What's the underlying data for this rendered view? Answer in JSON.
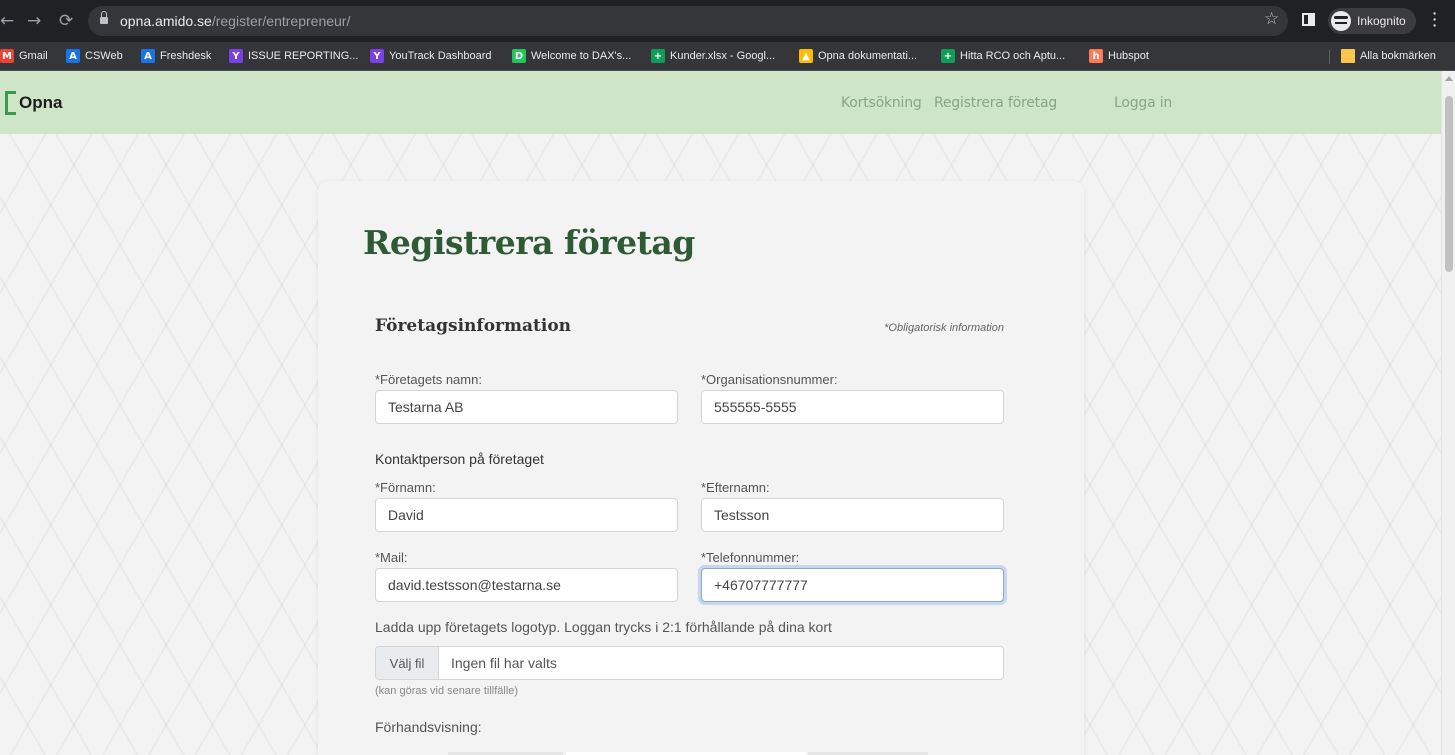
{
  "browser": {
    "url_host": "opna.amido.se",
    "url_path": "/register/entrepreneur/",
    "profile_label": "Inkognito",
    "bookmarks": [
      {
        "label": "Gmail",
        "icon": "gmail-icon",
        "color": "#ea4335"
      },
      {
        "label": "CSWeb",
        "icon": "a-icon",
        "color": "#1a73e8"
      },
      {
        "label": "Freshdesk",
        "icon": "a-icon",
        "color": "#1a73e8"
      },
      {
        "label": "ISSUE REPORTING...",
        "icon": "youtrack-icon",
        "color": "#7b3fe4"
      },
      {
        "label": "YouTrack Dashboard",
        "icon": "youtrack-icon",
        "color": "#7b3fe4"
      },
      {
        "label": "Welcome to DAX's...",
        "icon": "dax-icon",
        "color": "#22c55e"
      },
      {
        "label": "Kunder.xlsx - Googl...",
        "icon": "sheets-icon",
        "color": "#0f9d58"
      },
      {
        "label": "Opna dokumentati...",
        "icon": "drive-icon",
        "color": "#fbbc04"
      },
      {
        "label": "Hitta RCO och Aptu...",
        "icon": "sheets-icon",
        "color": "#0f9d58"
      },
      {
        "label": "Hubspot",
        "icon": "hubspot-icon",
        "color": "#ff7a59"
      }
    ],
    "all_bookmarks_label": "Alla bokmärken"
  },
  "header": {
    "logo_text": "Opna",
    "nav": {
      "card_search": "Kortsökning",
      "register_company": "Registrera företag",
      "login": "Logga in"
    }
  },
  "form": {
    "title": "Registrera företag",
    "section_title": "Företagsinformation",
    "required_note": "*Obligatorisk information",
    "company_name_label": "*Företagets namn:",
    "company_name_value": "Testarna AB",
    "org_number_label": "*Organisationsnummer:",
    "org_number_value": "555555-5555",
    "contact_heading": "Kontaktperson på företaget",
    "first_name_label": "*Förnamn:",
    "first_name_value": "David",
    "last_name_label": "*Efternamn:",
    "last_name_value": "Testsson",
    "mail_label": "*Mail:",
    "mail_value": "david.testsson@testarna.se",
    "phone_label": "*Telefonnummer:",
    "phone_value": "+46707777777",
    "upload_label": "Ladda upp företagets logotyp. Loggan trycks i 2:1 förhållande på dina kort",
    "file_button": "Välj fil",
    "file_status": "Ingen fil har valts",
    "upload_hint": "(kan göras vid senare tillfälle)",
    "preview_label": "Förhandsvisning:"
  },
  "colors": {
    "header_bg": "#cfe5c8",
    "title_green": "#2e5a35",
    "logo_green": "#3c9b4a"
  }
}
